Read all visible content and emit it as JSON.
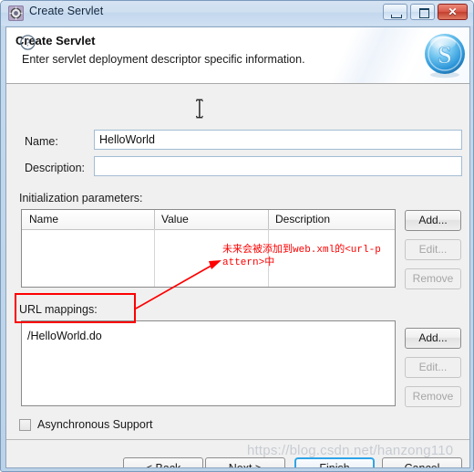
{
  "window": {
    "title": "Create Servlet",
    "icon": "gear-icon",
    "controls": {
      "minimize": "minimize-icon",
      "maximize": "maximize-icon",
      "close": "✕"
    }
  },
  "banner": {
    "title": "Create Servlet",
    "description": "Enter servlet deployment descriptor specific information.",
    "logo": "servlet-s-logo"
  },
  "form": {
    "name_label": "Name:",
    "name_value": "HelloWorld",
    "name_placeholder": "",
    "description_label": "Description:",
    "description_value": "",
    "description_placeholder": ""
  },
  "init_params": {
    "label": "Initialization parameters:",
    "columns": [
      "Name",
      "Value",
      "Description"
    ],
    "rows": [],
    "buttons": [
      {
        "label": "Add...",
        "enabled": true
      },
      {
        "label": "Edit...",
        "enabled": false
      },
      {
        "label": "Remove",
        "enabled": false
      }
    ]
  },
  "url_mappings": {
    "label": "URL mappings:",
    "items": [
      "/HelloWorld.do"
    ],
    "buttons": [
      {
        "label": "Add...",
        "enabled": true
      },
      {
        "label": "Edit...",
        "enabled": false
      },
      {
        "label": "Remove",
        "enabled": false
      }
    ]
  },
  "async": {
    "label": "Asynchronous Support",
    "checked": false
  },
  "footer": {
    "help": "help-icon",
    "back": "< Back",
    "next": "Next >",
    "finish": "Finish",
    "cancel": "Cancel"
  },
  "annotation": {
    "text": "未来会被添加到web.xml的<url-pattern>中",
    "color": "#fe0000"
  },
  "watermark": {
    "text": "https://blog.csdn.net/hanzong110"
  },
  "colors": {
    "dialog_bg": "#f0f0f0",
    "frame": "#c6d9ec",
    "accent": "#2fa4e7",
    "annotation": "#fe0000",
    "close_button": "#c23f2d"
  }
}
